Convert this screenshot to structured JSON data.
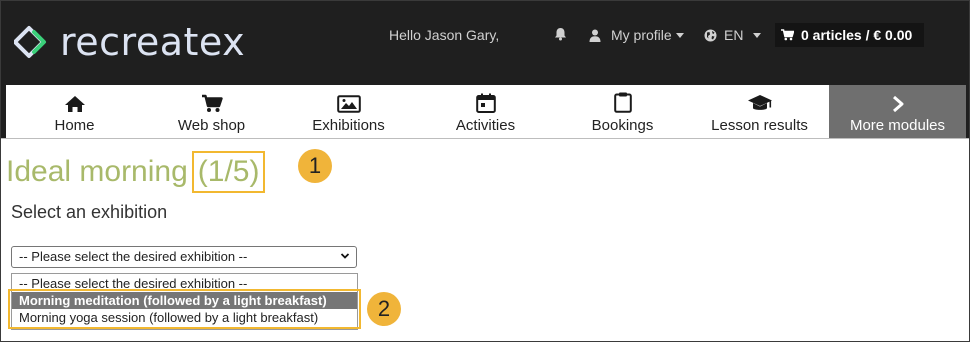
{
  "header": {
    "brand": "recreatex",
    "greeting": "Hello Jason Gary,",
    "profile_label": "My profile",
    "language_label": "EN",
    "cart_label": "0 articles / € 0.00",
    "icons": [
      "recreatex-logo-icon",
      "bell-icon",
      "user-icon",
      "globe-icon",
      "cart-icon"
    ]
  },
  "nav": {
    "items": [
      {
        "label": "Home",
        "icon": "home-icon"
      },
      {
        "label": "Web shop",
        "icon": "cart-icon"
      },
      {
        "label": "Exhibitions",
        "icon": "image-icon"
      },
      {
        "label": "Activities",
        "icon": "calendar-icon"
      },
      {
        "label": "Bookings",
        "icon": "clipboard-icon"
      },
      {
        "label": "Lesson results",
        "icon": "graduation-cap-icon"
      }
    ],
    "more_label": "More modules"
  },
  "main": {
    "title": "Ideal morning",
    "step_counter": "(1/5)",
    "section_label": "Select an exhibition",
    "select_value": "-- Please select the desired exhibition --",
    "options": [
      "-- Please select the desired exhibition --",
      "Morning meditation (followed by a light breakfast)",
      "Morning yoga session (followed by a light breakfast)"
    ],
    "highlighted_option_index": 1
  },
  "annotations": {
    "badge_1": "1",
    "badge_2": "2"
  },
  "colors": {
    "header_bg": "#1f1f1f",
    "title_green": "#a8b96a",
    "callout_orange": "#f0b43a",
    "more_modules_bg": "#6f6f6f",
    "selected_option_bg": "#767676"
  }
}
